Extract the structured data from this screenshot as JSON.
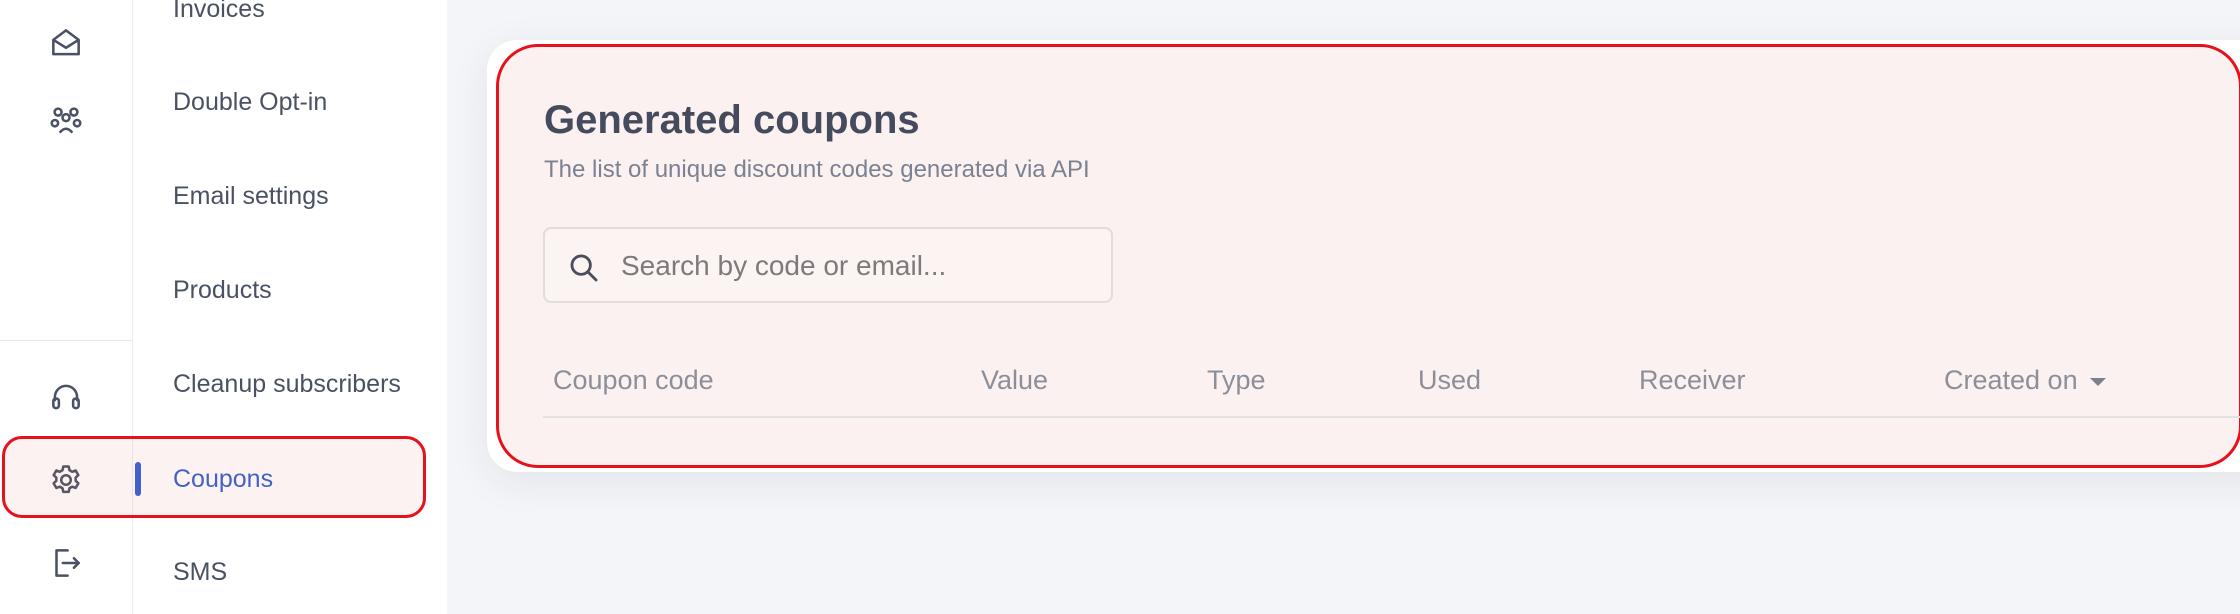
{
  "sidebar": {
    "items": [
      {
        "label": "Invoices"
      },
      {
        "label": "Double Opt-in"
      },
      {
        "label": "Email settings"
      },
      {
        "label": "Products"
      },
      {
        "label": "Cleanup subscribers"
      },
      {
        "label": "Coupons",
        "active": true
      },
      {
        "label": "SMS"
      }
    ],
    "icons": [
      "mail-open-icon",
      "audience-icon",
      "headset-icon",
      "gear-icon",
      "logout-icon"
    ]
  },
  "card": {
    "title": "Generated coupons",
    "subtitle": "The list of unique discount codes generated via API"
  },
  "search": {
    "placeholder": "Search by code or email..."
  },
  "table": {
    "columns": [
      "Coupon code",
      "Value",
      "Type",
      "Used",
      "Receiver",
      "Created on"
    ],
    "sort_column": "Created on",
    "sort_direction": "descending"
  },
  "colors": {
    "accent": "#2f5fd0",
    "highlight": "#e5121c"
  }
}
